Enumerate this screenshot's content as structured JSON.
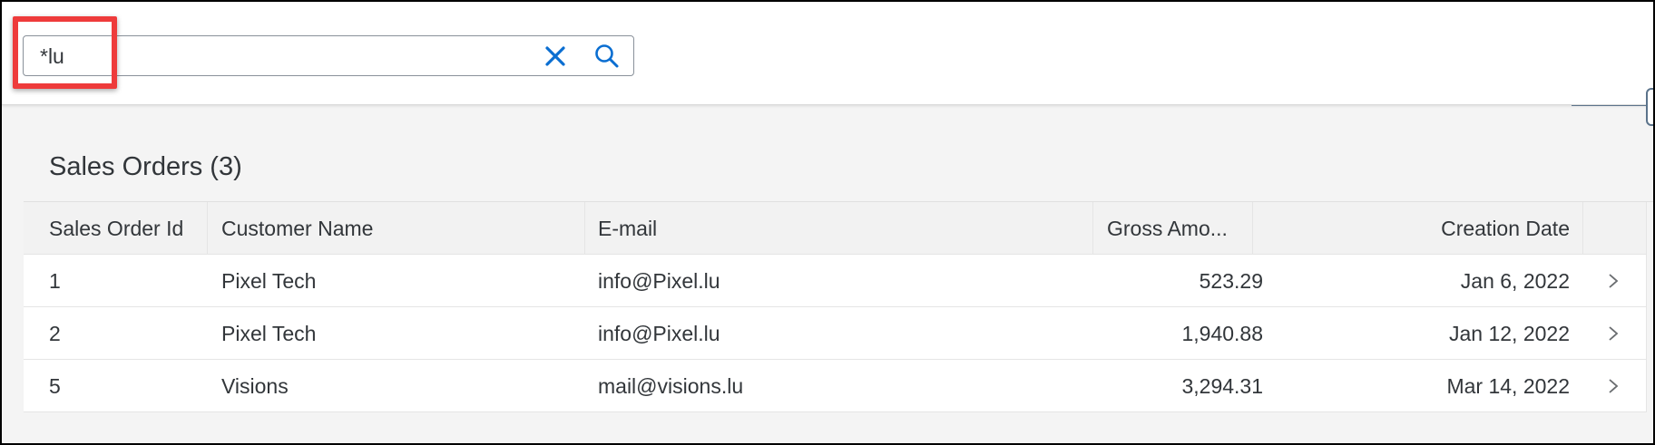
{
  "search": {
    "value": "*lu",
    "clear_icon": "close-icon",
    "search_icon": "search-icon"
  },
  "table": {
    "title": "Sales Orders (3)",
    "columns": [
      "Sales Order Id",
      "Customer Name",
      "E-mail",
      "Gross Amo...",
      "Creation Date"
    ],
    "rows": [
      {
        "id": "1",
        "customer": "Pixel Tech",
        "email": "info@Pixel.lu",
        "amount": "523.29",
        "date": "Jan 6, 2022"
      },
      {
        "id": "2",
        "customer": "Pixel Tech",
        "email": "info@Pixel.lu",
        "amount": "1,940.88",
        "date": "Jan 12, 2022"
      },
      {
        "id": "5",
        "customer": "Visions",
        "email": "mail@visions.lu",
        "amount": "3,294.31",
        "date": "Mar 14, 2022"
      }
    ],
    "row_nav_icon": "chevron-right-icon"
  },
  "colors": {
    "accent": "#0a6ed1",
    "highlight": "#ee3b3b",
    "text": "#32363a"
  }
}
